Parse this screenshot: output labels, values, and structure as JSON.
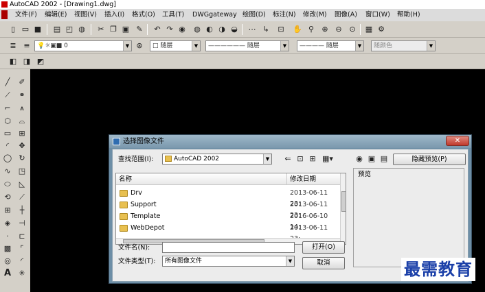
{
  "app": {
    "title": "AutoCAD 2002 - [Drawing1.dwg]",
    "menu": [
      "文件(F)",
      "编辑(E)",
      "视图(V)",
      "插入(I)",
      "格式(O)",
      "工具(T)",
      "DWGgateway",
      "绘图(D)",
      "标注(N)",
      "修改(M)",
      "图像(A)",
      "窗口(W)",
      "帮助(H)"
    ]
  },
  "toolbar": {
    "layer_value": "0",
    "color_value": "随层",
    "linetype_value": "—————— 随层",
    "lineweight_value": "———— 随层",
    "plotstyle_value": "随颜色"
  },
  "dialog": {
    "title": "选择图像文件",
    "close_label": "✕",
    "lookin_label": "查找范围(I):",
    "lookin_value": "AutoCAD 2002",
    "hide_preview_label": "隐藏预览(P)",
    "preview_label": "预览",
    "col_name": "名称",
    "col_date": "修改日期",
    "files": [
      {
        "name": "Drv",
        "date": "2013-06-11 23:"
      },
      {
        "name": "Support",
        "date": "2013-06-11 23:"
      },
      {
        "name": "Template",
        "date": "2016-06-10 14:"
      },
      {
        "name": "WebDepot",
        "date": "2013-06-11 23:"
      }
    ],
    "filename_label": "文件名(N):",
    "filename_value": "",
    "filetype_label": "文件类型(T):",
    "filetype_value": "所有图像文件",
    "open_label": "打开(O)",
    "cancel_label": "取消"
  },
  "watermark": "最需教育"
}
